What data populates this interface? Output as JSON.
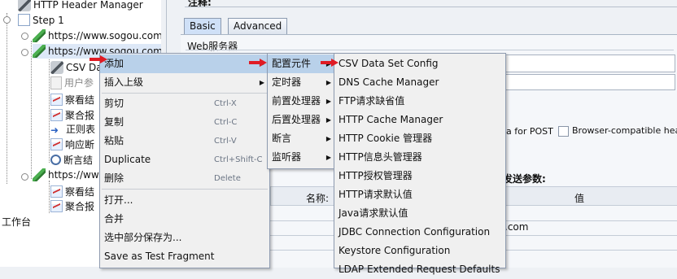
{
  "tree": {
    "items": [
      {
        "label": "HTTP Header Manager",
        "icon": "wrench-icon"
      },
      {
        "label": "Step 1",
        "icon": "thread-group-icon"
      },
      {
        "label": "https://www.sogou.com/",
        "icon": "sampler-pipette-icon"
      },
      {
        "label": "https://www.sogou.com/",
        "icon": "sampler-pipette-icon"
      },
      {
        "label": "CSV Da",
        "icon": "wrench-icon"
      },
      {
        "label": "用户参",
        "icon": "document-icon"
      },
      {
        "label": "察看结",
        "icon": "chart-icon"
      },
      {
        "label": "聚合报",
        "icon": "chart-icon"
      },
      {
        "label": "正则表",
        "icon": "arrow-right-icon"
      },
      {
        "label": "响应断",
        "icon": "chart-icon"
      },
      {
        "label": "断言结",
        "icon": "magnifier-icon"
      },
      {
        "label": "https://www",
        "icon": "sampler-pipette-icon"
      },
      {
        "label": "察看结",
        "icon": "chart-icon"
      },
      {
        "label": "聚合报",
        "icon": "chart-icon"
      }
    ],
    "workbench": "工作台"
  },
  "panel": {
    "top_label": "注释:",
    "tabs": [
      "Basic",
      "Advanced"
    ],
    "web_server_label": "Web服务器",
    "post_option": "a for POST",
    "browser_option": "Browser-compatible header",
    "send_params": "发送参数:",
    "col_name": "名称:",
    "col_value": "值",
    "domain_fragment": ".com"
  },
  "context_menu": {
    "items": [
      {
        "label": "添加",
        "has_sub": true,
        "highlight": true
      },
      {
        "label": "插入上级",
        "has_sub": true
      },
      {
        "label": "剪切",
        "shortcut": "Ctrl-X"
      },
      {
        "label": "复制",
        "shortcut": "Ctrl-C"
      },
      {
        "label": "粘贴",
        "shortcut": "Ctrl-V"
      },
      {
        "label": "Duplicate",
        "shortcut": "Ctrl+Shift-C"
      },
      {
        "label": "删除",
        "shortcut": "Delete"
      },
      {
        "label": "打开..."
      },
      {
        "label": "合并"
      },
      {
        "label": "选中部分保存为..."
      },
      {
        "label": "Save as Test Fragment"
      }
    ]
  },
  "add_submenu": {
    "items": [
      {
        "label": "配置元件",
        "highlight": true
      },
      {
        "label": "定时器"
      },
      {
        "label": "前置处理器"
      },
      {
        "label": "后置处理器"
      },
      {
        "label": "断言"
      },
      {
        "label": "监听器"
      }
    ]
  },
  "config_submenu": {
    "items": [
      "CSV Data Set Config",
      "DNS Cache Manager",
      "FTP请求缺省值",
      "HTTP Cache Manager",
      "HTTP Cookie 管理器",
      "HTTP信息头管理器",
      "HTTP授权管理器",
      "HTTP请求默认值",
      "Java请求默认值",
      "JDBC Connection Configuration",
      "Keystore Configuration",
      "LDAP Extended Request Defaults"
    ]
  },
  "colors": {
    "highlight": "#b9d1ea",
    "arrow": "#e01b24"
  }
}
